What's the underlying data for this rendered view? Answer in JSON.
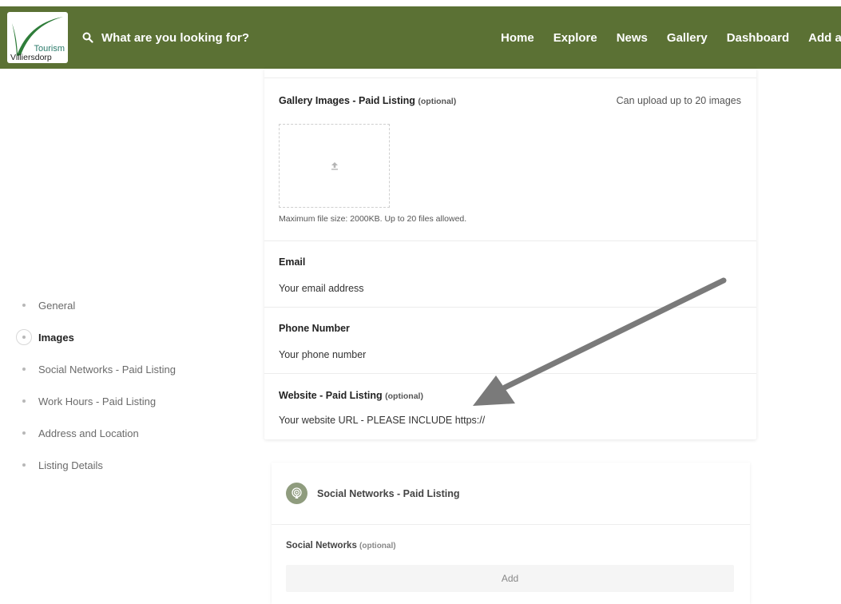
{
  "brand": {
    "logo_line1": "Tourism",
    "logo_line2": "Villiersdorp",
    "color": "#5b7134"
  },
  "header": {
    "search_placeholder": "What are you looking for?",
    "nav": [
      "Home",
      "Explore",
      "News",
      "Gallery",
      "Dashboard",
      "Add a List"
    ]
  },
  "sidebar": {
    "items": [
      {
        "label": "General",
        "active": false
      },
      {
        "label": "Images",
        "active": true
      },
      {
        "label": "Social Networks - Paid Listing",
        "active": false
      },
      {
        "label": "Work Hours - Paid Listing",
        "active": false
      },
      {
        "label": "Address and Location",
        "active": false
      },
      {
        "label": "Listing Details",
        "active": false
      }
    ]
  },
  "form": {
    "gallery": {
      "title": "Gallery Images - Paid Listing",
      "optional": "(optional)",
      "limit_note": "Can upload up to 20 images",
      "upload_hint": "Maximum file size: 2000KB. Up to 20 files allowed."
    },
    "email": {
      "title": "Email",
      "placeholder": "Your email address"
    },
    "phone": {
      "title": "Phone Number",
      "placeholder": "Your phone number"
    },
    "website": {
      "title": "Website - Paid Listing",
      "optional": "(optional)",
      "placeholder": "Your website URL - PLEASE INCLUDE https://"
    }
  },
  "social_section": {
    "heading": "Social Networks - Paid Listing",
    "field_title": "Social Networks",
    "optional": "(optional)",
    "add_label": "Add"
  },
  "icons": {
    "search": "search-icon",
    "upload": "upload-icon",
    "social": "podcast-icon",
    "annotation": "arrow-icon"
  }
}
